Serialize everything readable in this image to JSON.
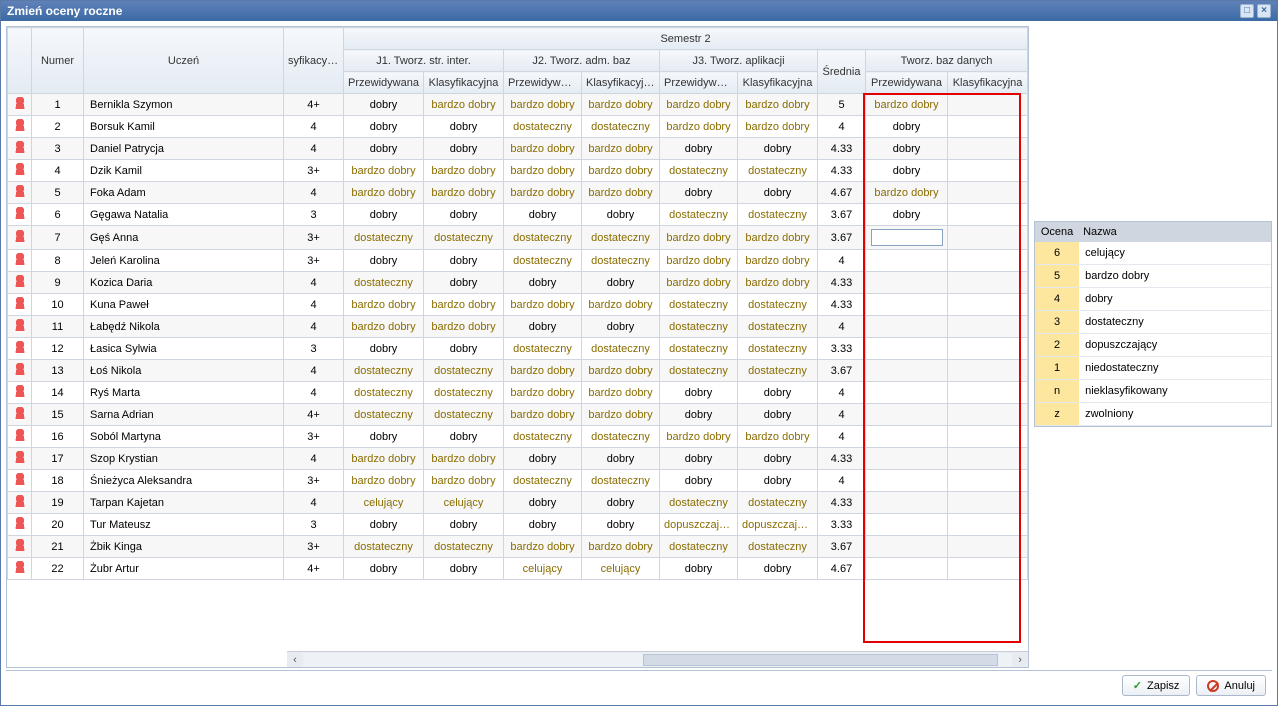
{
  "title": "Zmień oceny roczne",
  "headers": {
    "numer": "Numer",
    "uczen": "Uczeń",
    "syf": "syfikacyjna",
    "sem": "Semestr 2",
    "j1": "J1. Tworz. str. inter.",
    "j2": "J2. Tworz. adm. baz",
    "j3": "J3. Tworz. aplikacji",
    "tb": "Tworz. baz danych",
    "prz": "Przewidywana",
    "kla": "Klasyfikacyjna",
    "srednia": "Średnia"
  },
  "rows": [
    {
      "n": "1",
      "u": "Bernikla Szymon",
      "c0": "4+",
      "c1": "dobry",
      "c2": "bardzo dobry",
      "c3": "bardzo dobry",
      "c4": "bardzo dobry",
      "c5": "bardzo dobry",
      "c6": "bardzo dobry",
      "sr": "5",
      "p": "bardzo dobry"
    },
    {
      "n": "2",
      "u": "Borsuk Kamil",
      "c0": "4",
      "c1": "dobry",
      "c2": "dobry",
      "c3": "dostateczny",
      "c4": "dostateczny",
      "c5": "bardzo dobry",
      "c6": "bardzo dobry",
      "sr": "4",
      "p": "dobry"
    },
    {
      "n": "3",
      "u": "Daniel Patrycja",
      "c0": "4",
      "c1": "dobry",
      "c2": "dobry",
      "c3": "bardzo dobry",
      "c4": "bardzo dobry",
      "c5": "dobry",
      "c6": "dobry",
      "sr": "4.33",
      "p": "dobry"
    },
    {
      "n": "4",
      "u": "Dzik Kamil",
      "c0": "3+",
      "c1": "bardzo dobry",
      "c2": "bardzo dobry",
      "c3": "bardzo dobry",
      "c4": "bardzo dobry",
      "c5": "dostateczny",
      "c6": "dostateczny",
      "sr": "4.33",
      "p": "dobry"
    },
    {
      "n": "5",
      "u": "Foka Adam",
      "c0": "4",
      "c1": "bardzo dobry",
      "c2": "bardzo dobry",
      "c3": "bardzo dobry",
      "c4": "bardzo dobry",
      "c5": "dobry",
      "c6": "dobry",
      "sr": "4.67",
      "p": "bardzo dobry"
    },
    {
      "n": "6",
      "u": "Gęgawa Natalia",
      "c0": "3",
      "c1": "dobry",
      "c2": "dobry",
      "c3": "dobry",
      "c4": "dobry",
      "c5": "dostateczny",
      "c6": "dostateczny",
      "sr": "3.67",
      "p": "dobry"
    },
    {
      "n": "7",
      "u": "Gęś Anna",
      "c0": "3+",
      "c1": "dostateczny",
      "c2": "dostateczny",
      "c3": "dostateczny",
      "c4": "dostateczny",
      "c5": "bardzo dobry",
      "c6": "bardzo dobry",
      "sr": "3.67",
      "p": ""
    },
    {
      "n": "8",
      "u": "Jeleń Karolina",
      "c0": "3+",
      "c1": "dobry",
      "c2": "dobry",
      "c3": "dostateczny",
      "c4": "dostateczny",
      "c5": "bardzo dobry",
      "c6": "bardzo dobry",
      "sr": "4",
      "p": ""
    },
    {
      "n": "9",
      "u": "Kozica Daria",
      "c0": "4",
      "c1": "dostateczny",
      "c2": "dobry",
      "c3": "dobry",
      "c4": "dobry",
      "c5": "bardzo dobry",
      "c6": "bardzo dobry",
      "sr": "4.33",
      "p": ""
    },
    {
      "n": "10",
      "u": "Kuna Paweł",
      "c0": "4",
      "c1": "bardzo dobry",
      "c2": "bardzo dobry",
      "c3": "bardzo dobry",
      "c4": "bardzo dobry",
      "c5": "dostateczny",
      "c6": "dostateczny",
      "sr": "4.33",
      "p": ""
    },
    {
      "n": "11",
      "u": "Łabędź Nikola",
      "c0": "4",
      "c1": "bardzo dobry",
      "c2": "bardzo dobry",
      "c3": "dobry",
      "c4": "dobry",
      "c5": "dostateczny",
      "c6": "dostateczny",
      "sr": "4",
      "p": ""
    },
    {
      "n": "12",
      "u": "Łasica Sylwia",
      "c0": "3",
      "c1": "dobry",
      "c2": "dobry",
      "c3": "dostateczny",
      "c4": "dostateczny",
      "c5": "dostateczny",
      "c6": "dostateczny",
      "sr": "3.33",
      "p": ""
    },
    {
      "n": "13",
      "u": "Łoś Nikola",
      "c0": "4",
      "c1": "dostateczny",
      "c2": "dostateczny",
      "c3": "bardzo dobry",
      "c4": "bardzo dobry",
      "c5": "dostateczny",
      "c6": "dostateczny",
      "sr": "3.67",
      "p": ""
    },
    {
      "n": "14",
      "u": "Ryś Marta",
      "c0": "4",
      "c1": "dostateczny",
      "c2": "dostateczny",
      "c3": "bardzo dobry",
      "c4": "bardzo dobry",
      "c5": "dobry",
      "c6": "dobry",
      "sr": "4",
      "p": ""
    },
    {
      "n": "15",
      "u": "Sarna Adrian",
      "c0": "4+",
      "c1": "dostateczny",
      "c2": "dostateczny",
      "c3": "bardzo dobry",
      "c4": "bardzo dobry",
      "c5": "dobry",
      "c6": "dobry",
      "sr": "4",
      "p": ""
    },
    {
      "n": "16",
      "u": "Soból Martyna",
      "c0": "3+",
      "c1": "dobry",
      "c2": "dobry",
      "c3": "dostateczny",
      "c4": "dostateczny",
      "c5": "bardzo dobry",
      "c6": "bardzo dobry",
      "sr": "4",
      "p": ""
    },
    {
      "n": "17",
      "u": "Szop Krystian",
      "c0": "4",
      "c1": "bardzo dobry",
      "c2": "bardzo dobry",
      "c3": "dobry",
      "c4": "dobry",
      "c5": "dobry",
      "c6": "dobry",
      "sr": "4.33",
      "p": ""
    },
    {
      "n": "18",
      "u": "Śnieżyca Aleksandra",
      "c0": "3+",
      "c1": "bardzo dobry",
      "c2": "bardzo dobry",
      "c3": "dostateczny",
      "c4": "dostateczny",
      "c5": "dobry",
      "c6": "dobry",
      "sr": "4",
      "p": ""
    },
    {
      "n": "19",
      "u": "Tarpan Kajetan",
      "c0": "4",
      "c1": "celujący",
      "c2": "celujący",
      "c3": "dobry",
      "c4": "dobry",
      "c5": "dostateczny",
      "c6": "dostateczny",
      "sr": "4.33",
      "p": ""
    },
    {
      "n": "20",
      "u": "Tur Mateusz",
      "c0": "3",
      "c1": "dobry",
      "c2": "dobry",
      "c3": "dobry",
      "c4": "dobry",
      "c5": "dopuszczający",
      "c6": "dopuszczający",
      "sr": "3.33",
      "p": ""
    },
    {
      "n": "21",
      "u": "Żbik Kinga",
      "c0": "3+",
      "c1": "dostateczny",
      "c2": "dostateczny",
      "c3": "bardzo dobry",
      "c4": "bardzo dobry",
      "c5": "dostateczny",
      "c6": "dostateczny",
      "sr": "3.67",
      "p": ""
    },
    {
      "n": "22",
      "u": "Żubr Artur",
      "c0": "4+",
      "c1": "dobry",
      "c2": "dobry",
      "c3": "celujący",
      "c4": "celujący",
      "c5": "dobry",
      "c6": "dobry",
      "sr": "4.67",
      "p": ""
    }
  ],
  "legend": {
    "ocena": "Ocena",
    "nazwa": "Nazwa",
    "items": [
      {
        "code": "6",
        "name": "celujący"
      },
      {
        "code": "5",
        "name": "bardzo dobry"
      },
      {
        "code": "4",
        "name": "dobry"
      },
      {
        "code": "3",
        "name": "dostateczny"
      },
      {
        "code": "2",
        "name": "dopuszczający"
      },
      {
        "code": "1",
        "name": "niedostateczny"
      },
      {
        "code": "n",
        "name": "nieklasyfikowany"
      },
      {
        "code": "z",
        "name": "zwolniony"
      }
    ]
  },
  "buttons": {
    "save": "Zapisz",
    "cancel": "Anuluj"
  },
  "editRowIndex": 6
}
